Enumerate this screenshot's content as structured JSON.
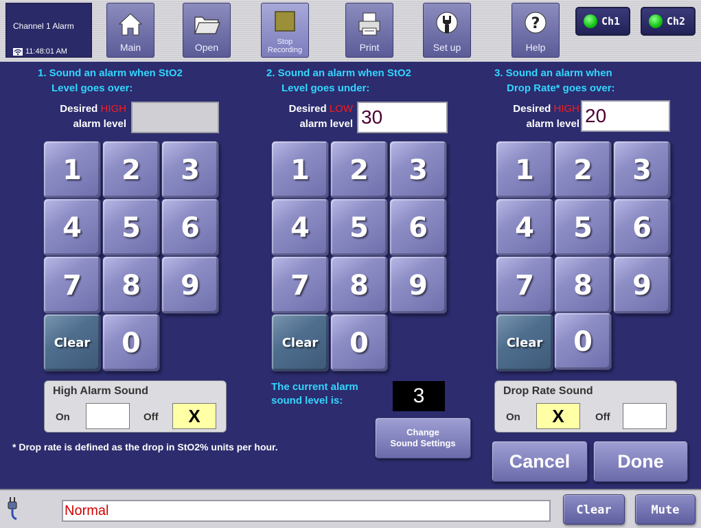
{
  "app": {
    "title": "Channel 1 Alarm",
    "time": "11:48:01 AM"
  },
  "toolbar": [
    {
      "label": "Main",
      "icon": "home-icon"
    },
    {
      "label": "Open",
      "icon": "folder-icon"
    },
    {
      "label": "Stop Recording",
      "line1": "Stop",
      "line2": "Recording",
      "icon": "stop-icon"
    },
    {
      "label": "Print",
      "icon": "printer-icon"
    },
    {
      "label": "Set up",
      "icon": "wrench-icon"
    },
    {
      "label": "Help",
      "icon": "help-icon"
    }
  ],
  "channels": [
    {
      "label": "Ch1",
      "status_color": "#13c213"
    },
    {
      "label": "Ch2",
      "status_color": "#13c213"
    }
  ],
  "col1": {
    "heading_line1": "1. Sound an alarm when StO2",
    "heading_line2": "Level goes over:",
    "desired": "Desired",
    "level_word": "HIGH",
    "alarm_level": "alarm level",
    "value": "",
    "clear": "Clear"
  },
  "col2": {
    "heading_line1": "2. Sound an alarm when StO2",
    "heading_line2": "Level goes under:",
    "desired": "Desired",
    "level_word": "LOW",
    "alarm_level": "alarm level",
    "value": "30",
    "clear": "Clear"
  },
  "col3": {
    "heading_line1": "3. Sound an alarm when",
    "heading_line2": "Drop Rate* goes over:",
    "desired": "Desired",
    "level_word": "HIGH",
    "alarm_level": "alarm level",
    "value": "20",
    "clear": "Clear"
  },
  "keys": [
    "1",
    "2",
    "3",
    "4",
    "5",
    "6",
    "7",
    "8",
    "9",
    "0"
  ],
  "high_alarm_sound": {
    "title": "High Alarm Sound",
    "on_label": "On",
    "off_label": "Off",
    "on_value": "",
    "off_value": "X"
  },
  "drop_rate_sound": {
    "title": "Drop Rate Sound",
    "on_label": "On",
    "off_label": "Off",
    "on_value": "X",
    "off_value": ""
  },
  "current_sound": {
    "line1": "The current alarm",
    "line2": "sound level is:",
    "value": "3"
  },
  "change_sound": {
    "line1": "Change",
    "line2": "Sound Settings"
  },
  "footnote": "* Drop rate is defined as the drop in StO2% units per hour.",
  "actions": {
    "cancel": "Cancel",
    "done": "Done"
  },
  "bottom": {
    "status": "Normal",
    "clear": "Clear",
    "mute": "Mute"
  },
  "colors": {
    "accent_text": "#33d6ff",
    "alert_text": "#ff1a1a",
    "background": "#2c2c6e",
    "status_text": "#d00000"
  }
}
